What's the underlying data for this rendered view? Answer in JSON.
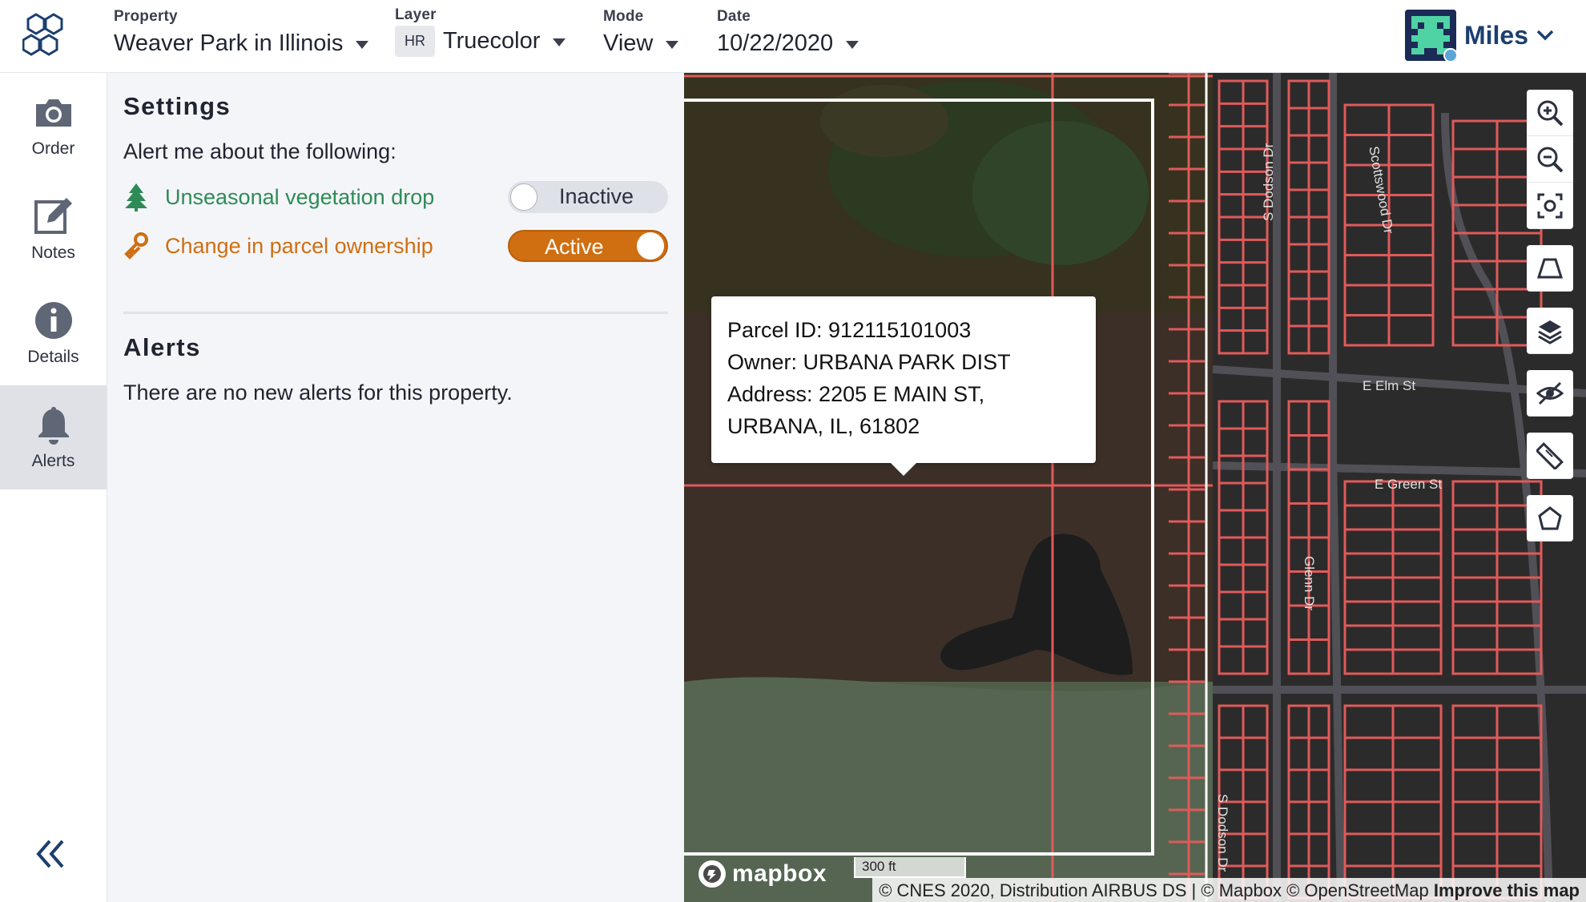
{
  "header": {
    "property": {
      "label": "Property",
      "value": "Weaver Park in Illinois"
    },
    "layer": {
      "label": "Layer",
      "badge": "HR",
      "value": "Truecolor"
    },
    "mode": {
      "label": "Mode",
      "value": "View"
    },
    "date": {
      "label": "Date",
      "value": "10/22/2020"
    },
    "user": {
      "name": "Miles"
    }
  },
  "rail": {
    "items": [
      {
        "label": "Order",
        "icon": "camera-icon"
      },
      {
        "label": "Notes",
        "icon": "edit-icon"
      },
      {
        "label": "Details",
        "icon": "info-icon"
      },
      {
        "label": "Alerts",
        "icon": "bell-icon",
        "active": true
      }
    ]
  },
  "settings": {
    "title": "Settings",
    "intro": "Alert me about the following:",
    "alerts": [
      {
        "label": "Unseasonal vegetation drop",
        "status": "Inactive",
        "color": "#2e8b57",
        "icon": "tree-icon"
      },
      {
        "label": "Change in parcel ownership",
        "status": "Active",
        "color": "#cf6f12",
        "icon": "key-icon"
      }
    ]
  },
  "alerts_section": {
    "title": "Alerts",
    "message": "There are no new alerts for this property."
  },
  "map": {
    "popup": {
      "line1": "Parcel ID: 912115101003",
      "line2": "Owner: URBANA PARK DIST",
      "line3": "Address: 2205 E MAIN ST,",
      "line4": "URBANA, IL, 61802"
    },
    "streets": {
      "s_dodson": "S Dodson Dr",
      "scottswood": "Scottswood Dr",
      "elm": "E Elm St",
      "green": "E Green St",
      "glenn": "Glenn Dr",
      "s_dodson_2": "S Dodson Dr"
    },
    "scale": "300 ft",
    "mapbox": "mapbox",
    "attribution": "© CNES 2020, Distribution AIRBUS DS | © Mapbox © OpenStreetMap",
    "improve": "Improve this map",
    "tools": [
      "zoom-in-icon",
      "zoom-out-icon",
      "fit-bounds-icon",
      "perspective-icon",
      "layers-icon",
      "hide-icon",
      "ruler-icon",
      "polygon-icon"
    ]
  }
}
